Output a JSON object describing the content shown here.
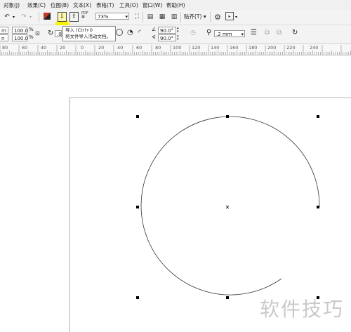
{
  "menu": [
    "对象(J)",
    "效果(C)",
    "位图(B)",
    "文本(X)",
    "表格(T)",
    "工具(O)",
    "窗口(W)",
    "帮助(H)"
  ],
  "toolbar": {
    "zoom_value": "73%",
    "snap_label": "贴齐(T)",
    "pdf_label": "PDF"
  },
  "property_bar": {
    "x_value": "m",
    "y_value": "n",
    "width_pct": "100.0",
    "height_pct": "100.0",
    "pct_unit": "%",
    "rotation_value": ".0",
    "start_angle": "90.0",
    "end_angle": "90.0",
    "degree_unit": "°",
    "outline_width": ".2 mm"
  },
  "tooltip": {
    "title": "导入 (Ctrl+I)",
    "body": "将文件导入活动文档。"
  },
  "ruler": {
    "labels": [
      "80",
      "60",
      "40",
      "20",
      "0",
      "20",
      "40",
      "60",
      "80",
      "100",
      "120",
      "140",
      "160",
      "180",
      "200",
      "220",
      "240"
    ]
  },
  "watermark": "软件技巧",
  "colors": {
    "highlight": "#f7f200",
    "canvas": "#ffffff"
  },
  "icons": [
    "undo-icon",
    "redo-icon",
    "import-icon",
    "export-icon",
    "fullscreen-icon",
    "gear-icon",
    "crosshair-icon"
  ]
}
